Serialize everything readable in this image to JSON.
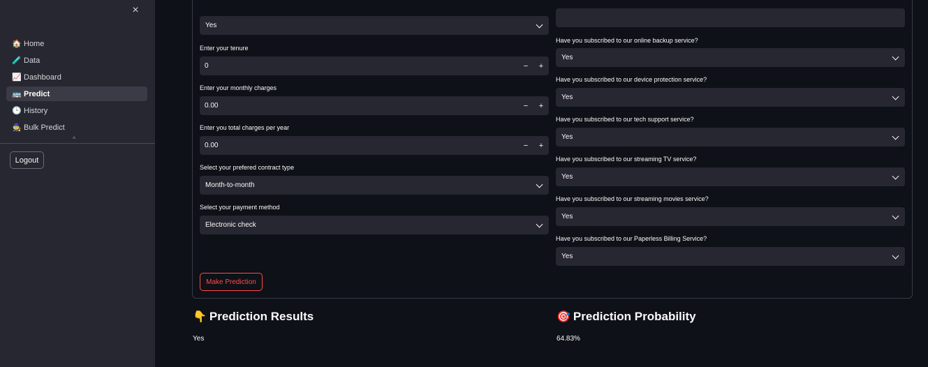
{
  "sidebar": {
    "close_icon": "×",
    "items": [
      {
        "icon": "🏠",
        "label": "Home"
      },
      {
        "icon": "🧪",
        "label": "Data"
      },
      {
        "icon": "📈",
        "label": "Dashboard"
      },
      {
        "icon": "🚌",
        "label": "Predict"
      },
      {
        "icon": "🕒",
        "label": "History"
      },
      {
        "icon": "🧙",
        "label": "Bulk Predict"
      }
    ],
    "active_item": "Predict",
    "collapse_icon": "^",
    "logout_label": "Logout"
  },
  "form": {
    "left": {
      "top_select_value": "Yes",
      "tenure": {
        "label": "Enter your tenure",
        "value": "0"
      },
      "monthly_charges": {
        "label": "Enter your monthly charges",
        "value": "0.00"
      },
      "total_charges": {
        "label": "Enter you total charges per year",
        "value": "0.00"
      },
      "contract": {
        "label": "Select your prefered contract type",
        "value": "Month-to-month"
      },
      "payment": {
        "label": "Select your payment method",
        "value": "Electronic check"
      }
    },
    "right": {
      "online_backup": {
        "label": "Have you subscribed to our online backup service?",
        "value": "Yes"
      },
      "device_protection": {
        "label": "Have you subscribed to our device protection service?",
        "value": "Yes"
      },
      "tech_support": {
        "label": "Have you subscribed to our tech support service?",
        "value": "Yes"
      },
      "streaming_tv": {
        "label": "Have you subscribed to our streaming TV service?",
        "value": "Yes"
      },
      "streaming_movies": {
        "label": "Have you subscribed to our streaming movies service?",
        "value": "Yes"
      },
      "paperless_billing": {
        "label": "Have you subscribed to our Paperless Billing Service?",
        "value": "Yes"
      }
    },
    "minus": "−",
    "plus": "+",
    "submit_label": "Make Prediction"
  },
  "results": {
    "prediction": {
      "icon": "👇",
      "title": "Prediction Results",
      "value": "Yes"
    },
    "probability": {
      "icon": "🎯",
      "title": "Prediction Probability",
      "value": "64.83%"
    }
  }
}
